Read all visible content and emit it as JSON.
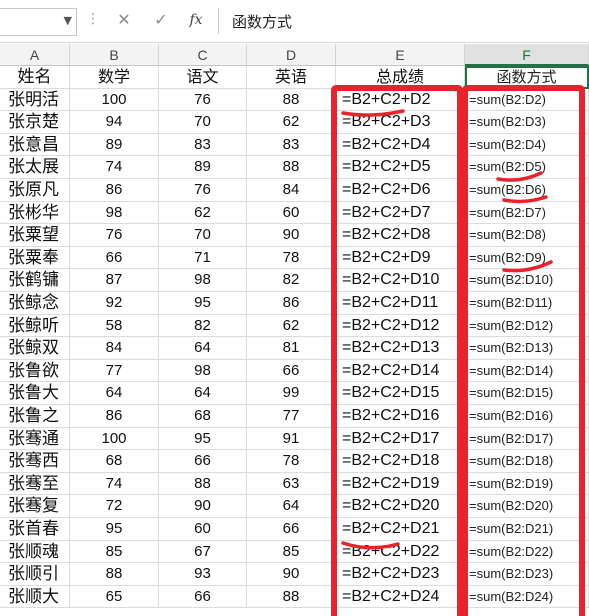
{
  "formula_bar": {
    "name_box": "",
    "cancel_glyph": "✕",
    "confirm_glyph": "✓",
    "fx_label": "fx",
    "content": "函数方式"
  },
  "columns": [
    "A",
    "B",
    "C",
    "D",
    "E",
    "F"
  ],
  "header_row": [
    "姓名",
    "数学",
    "语文",
    "英语",
    "总成绩",
    "函数方式"
  ],
  "rows": [
    [
      "张明活",
      "100",
      "76",
      "88",
      "=B2+C2+D2",
      "=sum(B2:D2)"
    ],
    [
      "张京楚",
      "94",
      "70",
      "62",
      "=B2+C2+D3",
      "=sum(B2:D3)"
    ],
    [
      "张意昌",
      "89",
      "83",
      "83",
      "=B2+C2+D4",
      "=sum(B2:D4)"
    ],
    [
      "张太展",
      "74",
      "89",
      "88",
      "=B2+C2+D5",
      "=sum(B2:D5)"
    ],
    [
      "张原凡",
      "86",
      "76",
      "84",
      "=B2+C2+D6",
      "=sum(B2:D6)"
    ],
    [
      "张彬华",
      "98",
      "62",
      "60",
      "=B2+C2+D7",
      "=sum(B2:D7)"
    ],
    [
      "张粟望",
      "76",
      "70",
      "90",
      "=B2+C2+D8",
      "=sum(B2:D8)"
    ],
    [
      "张粟奉",
      "66",
      "71",
      "78",
      "=B2+C2+D9",
      "=sum(B2:D9)"
    ],
    [
      "张鹤镛",
      "87",
      "98",
      "82",
      "=B2+C2+D10",
      "=sum(B2:D10)"
    ],
    [
      "张鲸念",
      "92",
      "95",
      "86",
      "=B2+C2+D11",
      "=sum(B2:D11)"
    ],
    [
      "张鲸听",
      "58",
      "82",
      "62",
      "=B2+C2+D12",
      "=sum(B2:D12)"
    ],
    [
      "张鲸双",
      "84",
      "64",
      "81",
      "=B2+C2+D13",
      "=sum(B2:D13)"
    ],
    [
      "张鲁欲",
      "77",
      "98",
      "66",
      "=B2+C2+D14",
      "=sum(B2:D14)"
    ],
    [
      "张鲁大",
      "64",
      "64",
      "99",
      "=B2+C2+D15",
      "=sum(B2:D15)"
    ],
    [
      "张鲁之",
      "86",
      "68",
      "77",
      "=B2+C2+D16",
      "=sum(B2:D16)"
    ],
    [
      "张骞通",
      "100",
      "95",
      "91",
      "=B2+C2+D17",
      "=sum(B2:D17)"
    ],
    [
      "张骞西",
      "68",
      "66",
      "78",
      "=B2+C2+D18",
      "=sum(B2:D18)"
    ],
    [
      "张骞至",
      "74",
      "88",
      "63",
      "=B2+C2+D19",
      "=sum(B2:D19)"
    ],
    [
      "张骞复",
      "72",
      "90",
      "64",
      "=B2+C2+D20",
      "=sum(B2:D20)"
    ],
    [
      "张首春",
      "95",
      "60",
      "66",
      "=B2+C2+D21",
      "=sum(B2:D21)"
    ],
    [
      "张顺魂",
      "85",
      "67",
      "85",
      "=B2+C2+D22",
      "=sum(B2:D22)"
    ],
    [
      "张顺引",
      "88",
      "93",
      "90",
      "=B2+C2+D23",
      "=sum(B2:D23)"
    ],
    [
      "张顺大",
      "65",
      "66",
      "88",
      "=B2+C2+D24",
      "=sum(B2:D24)"
    ]
  ],
  "colors": {
    "annotation_red": "#e8232b",
    "selection_green": "#217346"
  }
}
